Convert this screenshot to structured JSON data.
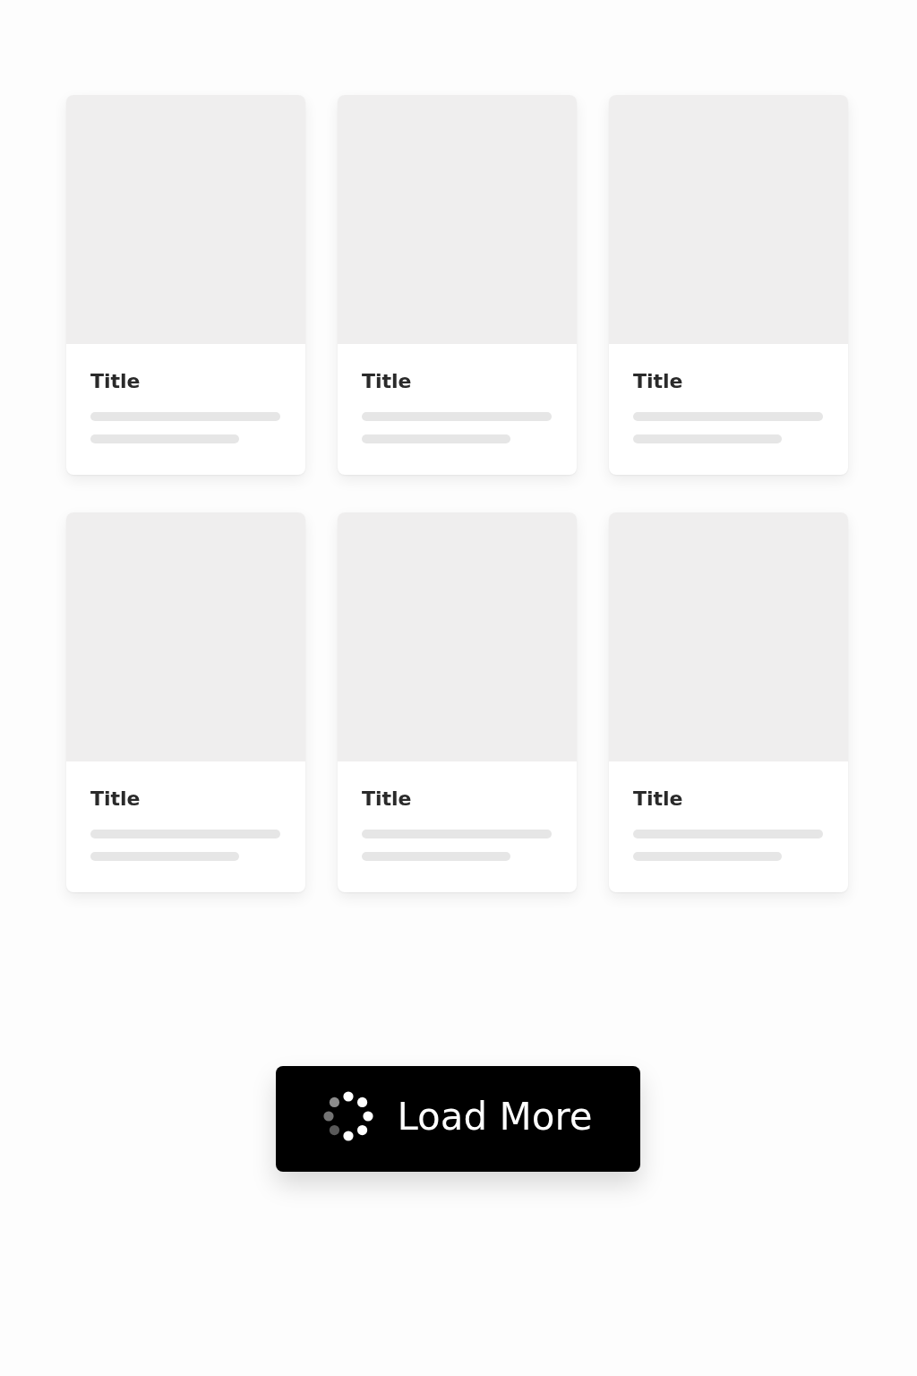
{
  "cards": [
    {
      "title": "Title"
    },
    {
      "title": "Title"
    },
    {
      "title": "Title"
    },
    {
      "title": "Title"
    },
    {
      "title": "Title"
    },
    {
      "title": "Title"
    }
  ],
  "load_more": {
    "label": "Load More",
    "loading": true
  }
}
